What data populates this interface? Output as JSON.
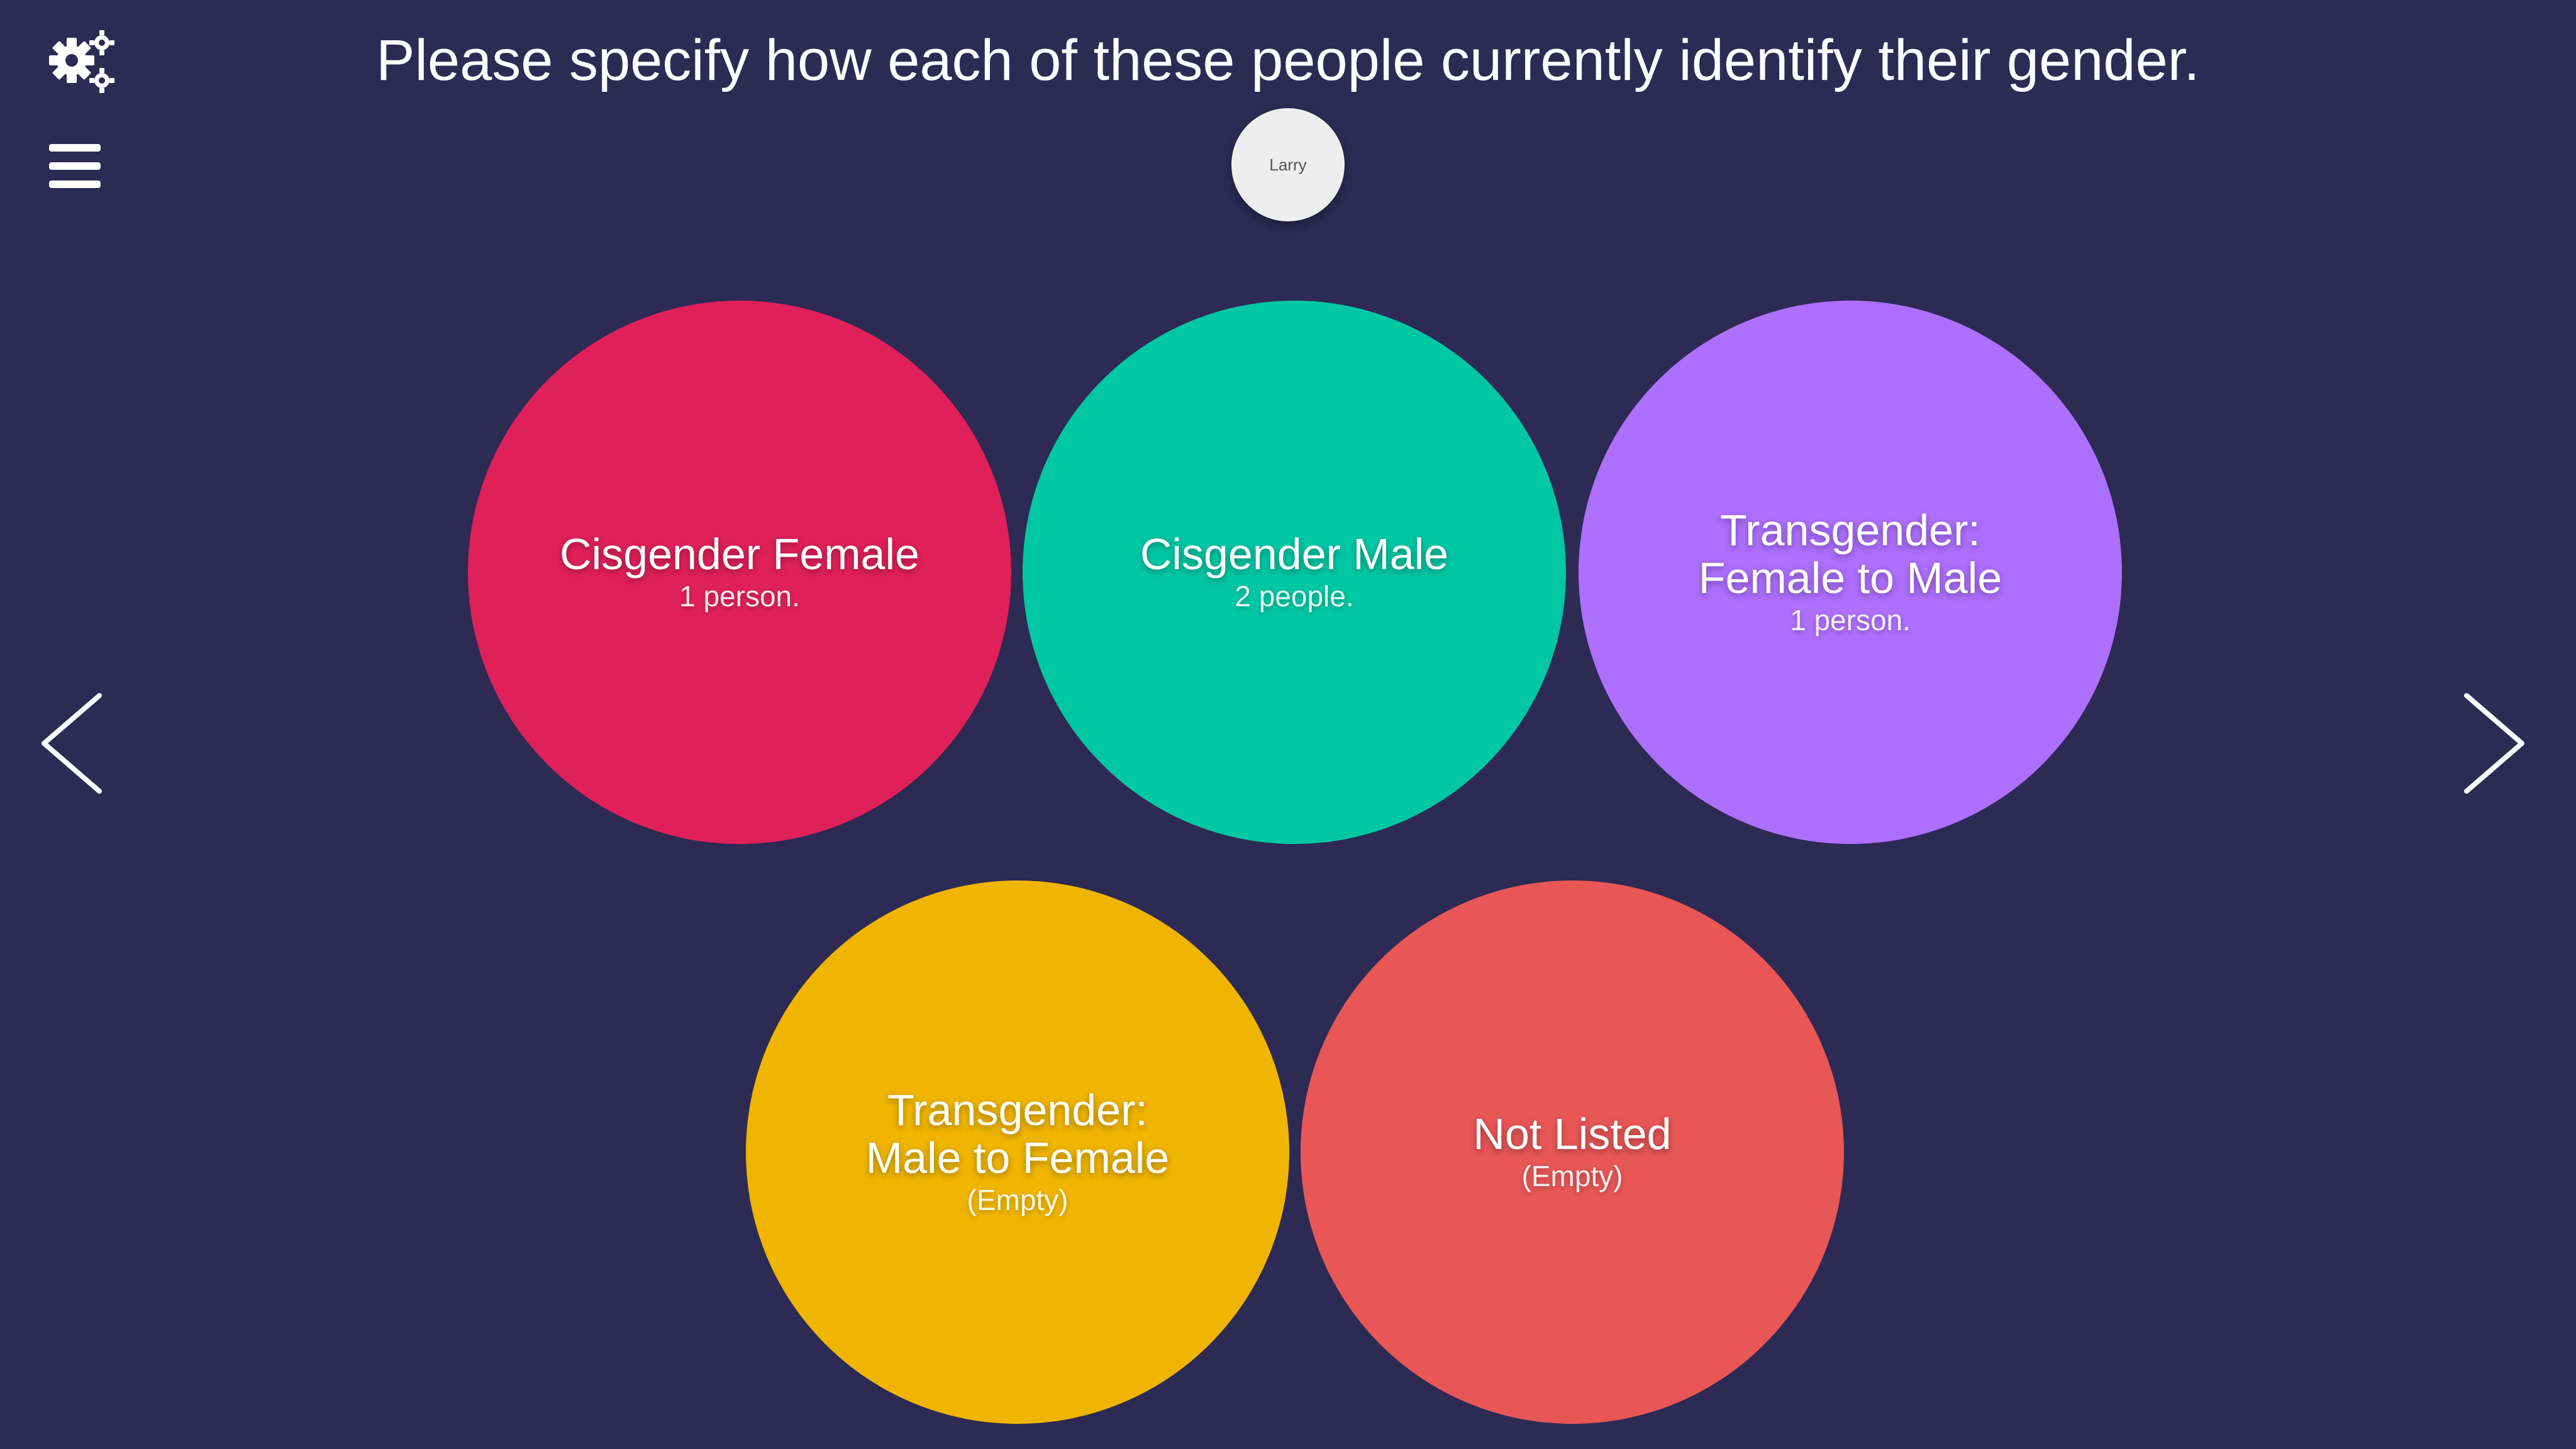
{
  "header": {
    "prompt": "Please specify how each of these people currently identify their gender."
  },
  "toolbar": {
    "settings_icon": "gears-icon",
    "menu_icon": "hamburger-menu-icon"
  },
  "person": {
    "label": "Larry"
  },
  "categories": [
    {
      "title": "Cisgender Female",
      "count": "1 person.",
      "color": "#e02059"
    },
    {
      "title": "Cisgender Male",
      "count": "2 people.",
      "color": "#00c7a3"
    },
    {
      "title": "Transgender:\nFemale to Male",
      "count": "1 person.",
      "color": "#ad6ffd"
    },
    {
      "title": "Transgender:\nMale to Female",
      "count": "(Empty)",
      "color": "#f0b500"
    },
    {
      "title": "Not Listed",
      "count": "(Empty)",
      "color": "#e85656"
    }
  ],
  "navigation": {
    "prev_icon": "chevron-left-icon",
    "next_icon": "chevron-right-icon"
  },
  "theme": {
    "background": "#2d2a54"
  }
}
